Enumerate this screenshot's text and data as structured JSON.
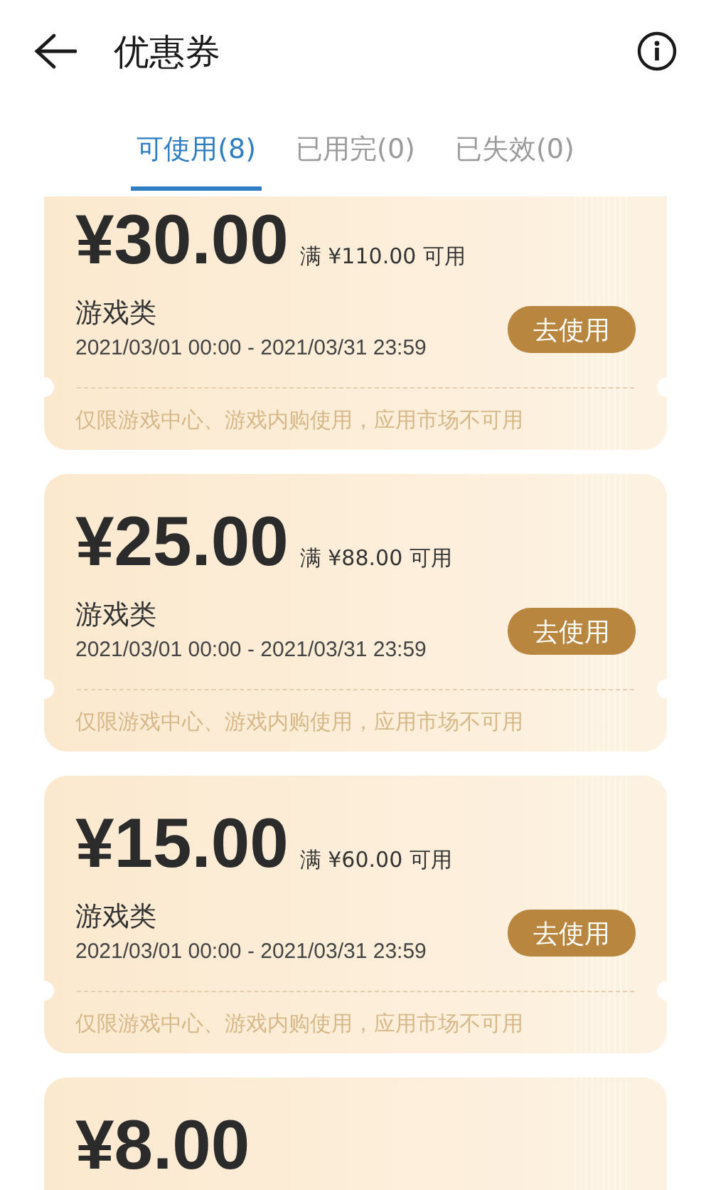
{
  "header": {
    "title": "优惠券"
  },
  "tabs": [
    {
      "label": "可使用(8)",
      "selected": true
    },
    {
      "label": "已用完(0)",
      "selected": false
    },
    {
      "label": "已失效(0)",
      "selected": false
    }
  ],
  "coupons": [
    {
      "amount": "¥30.00",
      "condition": "满 ¥110.00 可用",
      "category": "游戏类",
      "validity": "2021/03/01 00:00 - 2021/03/31 23:59",
      "button": "去使用",
      "note": "仅限游戏中心、游戏内购使用，应用市场不可用"
    },
    {
      "amount": "¥25.00",
      "condition": "满 ¥88.00 可用",
      "category": "游戏类",
      "validity": "2021/03/01 00:00 - 2021/03/31 23:59",
      "button": "去使用",
      "note": "仅限游戏中心、游戏内购使用，应用市场不可用"
    },
    {
      "amount": "¥15.00",
      "condition": "满 ¥60.00 可用",
      "category": "游戏类",
      "validity": "2021/03/01 00:00 - 2021/03/31 23:59",
      "button": "去使用",
      "note": "仅限游戏中心、游戏内购使用，应用市场不可用"
    },
    {
      "amount": "¥8.00"
    }
  ]
}
